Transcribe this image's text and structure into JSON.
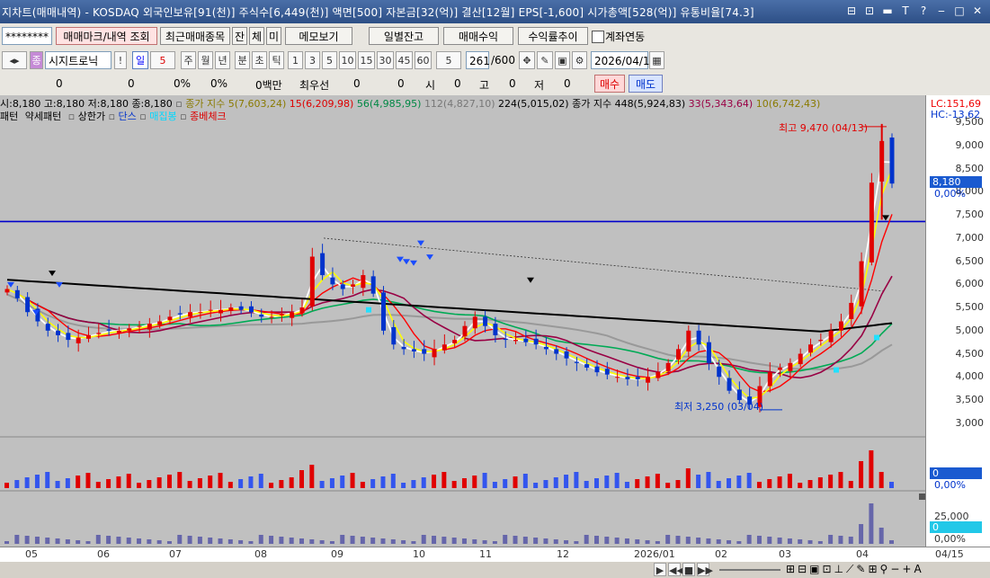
{
  "window": {
    "title": "지차트(매매내역) - KOSDAQ 외국인보유[91(천)] 주식수[6,449(천)] 액면[500] 자본금[32(억)] 결산[12월] EPS[-1,600] 시가총액[528(억)] 유통비율[74.3]",
    "controls": [
      "⊟",
      "⊡",
      "▬",
      "T",
      "?",
      "‒",
      "□",
      "✕"
    ]
  },
  "toolbar1": {
    "account": "********",
    "trade_mark": "매매마크/내역 조회",
    "recent": "최근매매종목",
    "jan": "잔",
    "che": "체",
    "mi": "미",
    "memo": "메모보기",
    "daily_balance": "일별잔고",
    "trade_profit": "매매수익",
    "return_trend": "수익률추이",
    "account_link": "계좌연동"
  },
  "toolbar2": {
    "stock_name": "시지트로닉",
    "period_selected": "일",
    "period_count": "5",
    "periods": [
      "주",
      "월",
      "년",
      "분",
      "초",
      "틱"
    ],
    "intervals": [
      "1",
      "3",
      "5",
      "10",
      "15",
      "30",
      "45",
      "60"
    ],
    "interval_sel": "5",
    "count": "261",
    "count_total": "/600",
    "date": "2026/04/15"
  },
  "toolbar3": {
    "v1": "0",
    "v2": "0",
    "p1": "0%",
    "p2": "0%",
    "amount": "0백만",
    "best": "최우선",
    "b1": "0",
    "b2": "0",
    "o_label": "시",
    "o_val": "0",
    "h_label": "고",
    "h_val": "0",
    "l_label": "저",
    "l_val": "0",
    "buy": "매수",
    "sell": "매도"
  },
  "legend": {
    "ohlc": "시:8,180 고:8,180 저:8,180 종:8,180",
    "ma5": "종가 지수 5(7,603,24)",
    "ma15": "15(6,209,98)",
    "ma56": "56(4,985,95)",
    "ma112": "112(4,827,10)",
    "ma224": "224(5,015,02)",
    "ma448": "종가 지수 448(5,924,83)",
    "ma33": "33(5,343,64)",
    "ma10": "10(6,742,43)",
    "lc": "LC:151,69",
    "hc": "HC:-13,62",
    "patterns": [
      "패턴",
      "약세패턴",
      "상한가",
      "단스",
      "매집봉",
      "종베체크"
    ]
  },
  "annotations": {
    "high": "최고 9,470 (04/13)",
    "low": "최저 3,250 (03/04)"
  },
  "yaxis": {
    "ticks": [
      "9,500",
      "9,000",
      "8,500",
      "8,000",
      "7,500",
      "7,000",
      "6,500",
      "6,000",
      "5,500",
      "5,000",
      "4,500",
      "4,000",
      "3,500",
      "3,000"
    ],
    "current": "8,180",
    "current_pct": "0,00%",
    "vol_cur": "0",
    "vol_pct": "0,00%",
    "sub_tick": "25,000",
    "sub_cur": "0",
    "sub_pct": "0,00%"
  },
  "xaxis": {
    "labels": [
      "05",
      "06",
      "07",
      "08",
      "09",
      "10",
      "11",
      "12",
      "2026/01",
      "02",
      "03",
      "04"
    ],
    "end_date": "04/15"
  },
  "colors": {
    "up": "#e00000",
    "down": "#0033cc",
    "ma5": "#ffff00",
    "ma15": "#ff0000",
    "ma56": "#00aa55",
    "ma112": "#999999",
    "ma448": "#000000",
    "ma33": "#990044",
    "hline": "#0000cc"
  },
  "chart_data": {
    "type": "line",
    "title": "",
    "price_close": [
      5900,
      5700,
      5400,
      5200,
      5000,
      4900,
      4800,
      4850,
      4900,
      4950,
      5000,
      5000,
      5050,
      5100,
      5150,
      5200,
      5300,
      5350,
      5400,
      5400,
      5450,
      5450,
      5500,
      5450,
      5400,
      5300,
      5300,
      5350,
      5400,
      5500,
      6600,
      6200,
      6000,
      5900,
      6000,
      6200,
      5800,
      5000,
      4700,
      4600,
      4550,
      4500,
      4600,
      4700,
      4800,
      5100,
      5300,
      5100,
      4900,
      4800,
      4800,
      4750,
      4700,
      4600,
      4500,
      4400,
      4300,
      4200,
      4100,
      4050,
      4000,
      3950,
      3950,
      4000,
      4100,
      4300,
      4600,
      5000,
      4700,
      4300,
      4000,
      3700,
      3500,
      3400,
      3800,
      4100,
      4200,
      4300,
      4500,
      4700,
      4800,
      5000,
      5200,
      5600,
      6500,
      8200,
      9100,
      8180
    ],
    "hline": 7360,
    "high": {
      "value": 9470,
      "date": "04/13"
    },
    "low": {
      "value": 3250,
      "date": "03/04"
    },
    "ylim": [
      2800,
      9700
    ]
  }
}
